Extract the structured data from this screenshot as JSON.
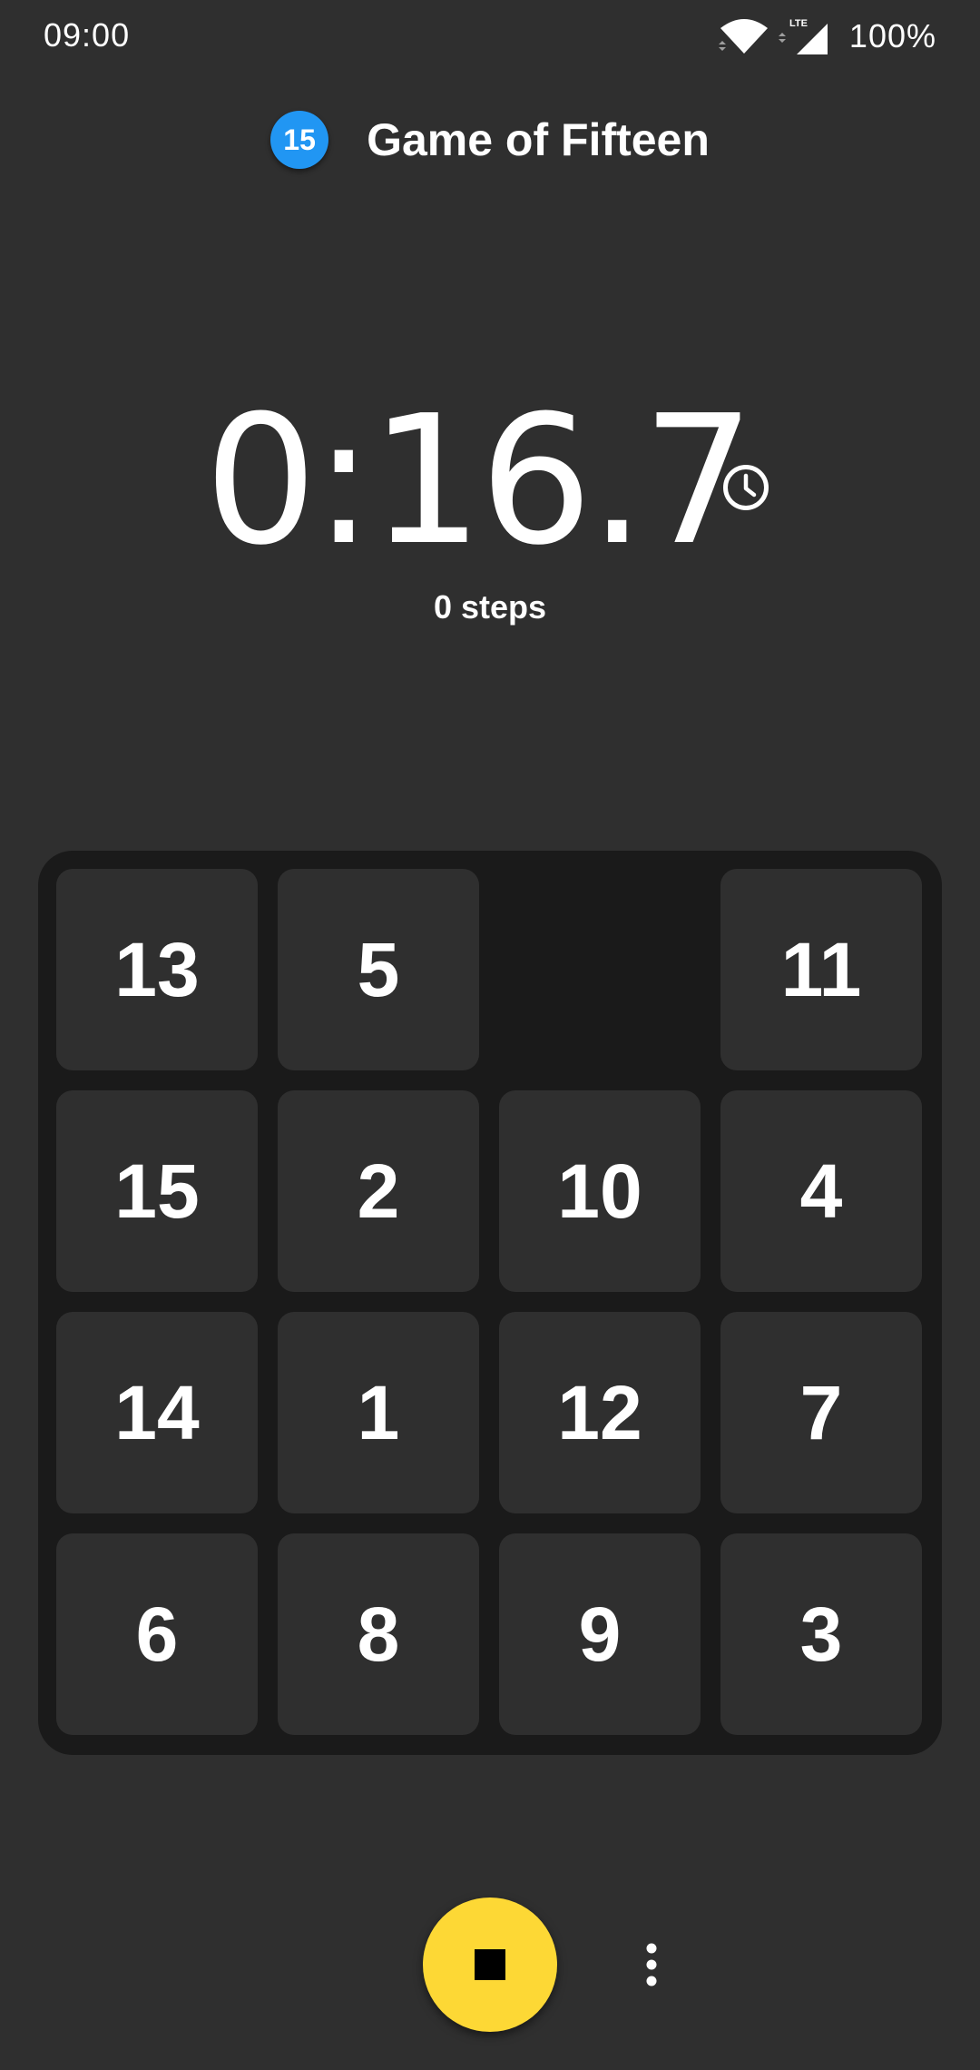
{
  "status_bar": {
    "time": "09:00",
    "network_label": "LTE",
    "battery": "100%"
  },
  "header": {
    "logo_text": "15",
    "title": "Game of Fifteen"
  },
  "timer": {
    "value": "0:16.7",
    "steps": "0 steps"
  },
  "board": {
    "rows": [
      [
        "13",
        "5",
        "",
        "11"
      ],
      [
        "15",
        "2",
        "10",
        "4"
      ],
      [
        "14",
        "1",
        "12",
        "7"
      ],
      [
        "6",
        "8",
        "9",
        "3"
      ]
    ]
  },
  "icons": {
    "clock": "clock-icon",
    "stop": "stop-icon",
    "more": "more-vertical-icon",
    "wifi": "wifi-icon",
    "signal": "signal-icon"
  },
  "colors": {
    "background": "#2f2f2f",
    "board": "#1a1a1a",
    "tile": "#2f2f2f",
    "logo": "#2196f3",
    "stop_button": "#fdd835"
  }
}
